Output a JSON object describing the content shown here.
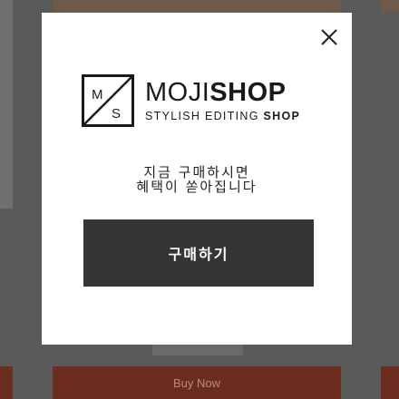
{
  "background": {
    "buy_now_label": "Buy Now"
  },
  "modal": {
    "close_icon": "close-icon",
    "logo": {
      "mark_letters": [
        "M",
        "S"
      ],
      "brand_regular": "MOJI",
      "brand_bold": "SHOP",
      "tagline_regular": "STYLISH EDITING ",
      "tagline_bold": "SHOP"
    },
    "message_line1": "지금 구매하시면",
    "message_line2": "혜택이 쏟아집니다",
    "cta_label": "구매하기"
  },
  "colors": {
    "overlay": "#5a5a5a",
    "modal_bg": "#ffffff",
    "cta_bg": "#353535",
    "buy_now_bg": "#6b2e1e"
  }
}
